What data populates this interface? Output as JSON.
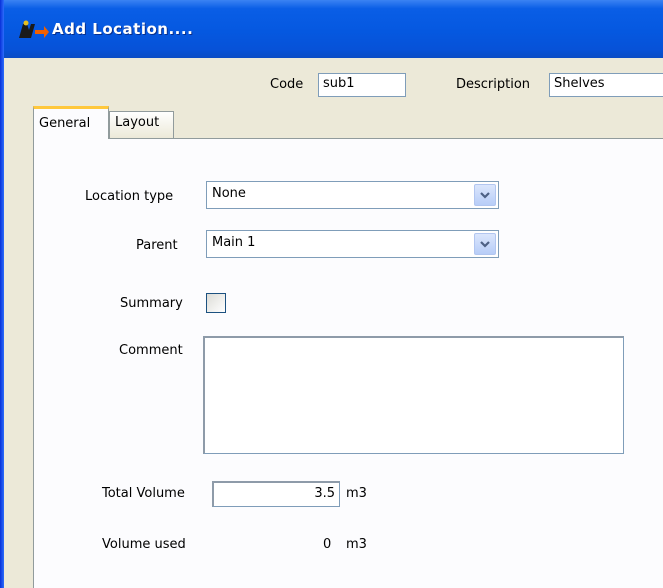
{
  "window": {
    "title": "Add Location....",
    "icon": "location-app-icon"
  },
  "header": {
    "code_label": "Code",
    "code_value": "sub1",
    "description_label": "Description",
    "description_value": "Shelves"
  },
  "tabs": [
    {
      "label": "General",
      "active": true
    },
    {
      "label": "Layout",
      "active": false
    }
  ],
  "form": {
    "location_type_label": "Location type",
    "location_type_value": "None",
    "parent_label": "Parent",
    "parent_value": "Main 1",
    "summary_label": "Summary",
    "summary_checked": false,
    "comment_label": "Comment",
    "comment_value": "",
    "total_volume_label": "Total Volume",
    "total_volume_value": "3.5",
    "total_volume_unit": "m3",
    "volume_used_label": "Volume used",
    "volume_used_value": "0",
    "volume_used_unit": "m3"
  },
  "icons": {
    "dropdown": "chevron-down-icon"
  },
  "colors": {
    "titlebar": "#0558e0",
    "tab_highlight": "#ffc83c",
    "dialog_background": "#ece9d8"
  }
}
